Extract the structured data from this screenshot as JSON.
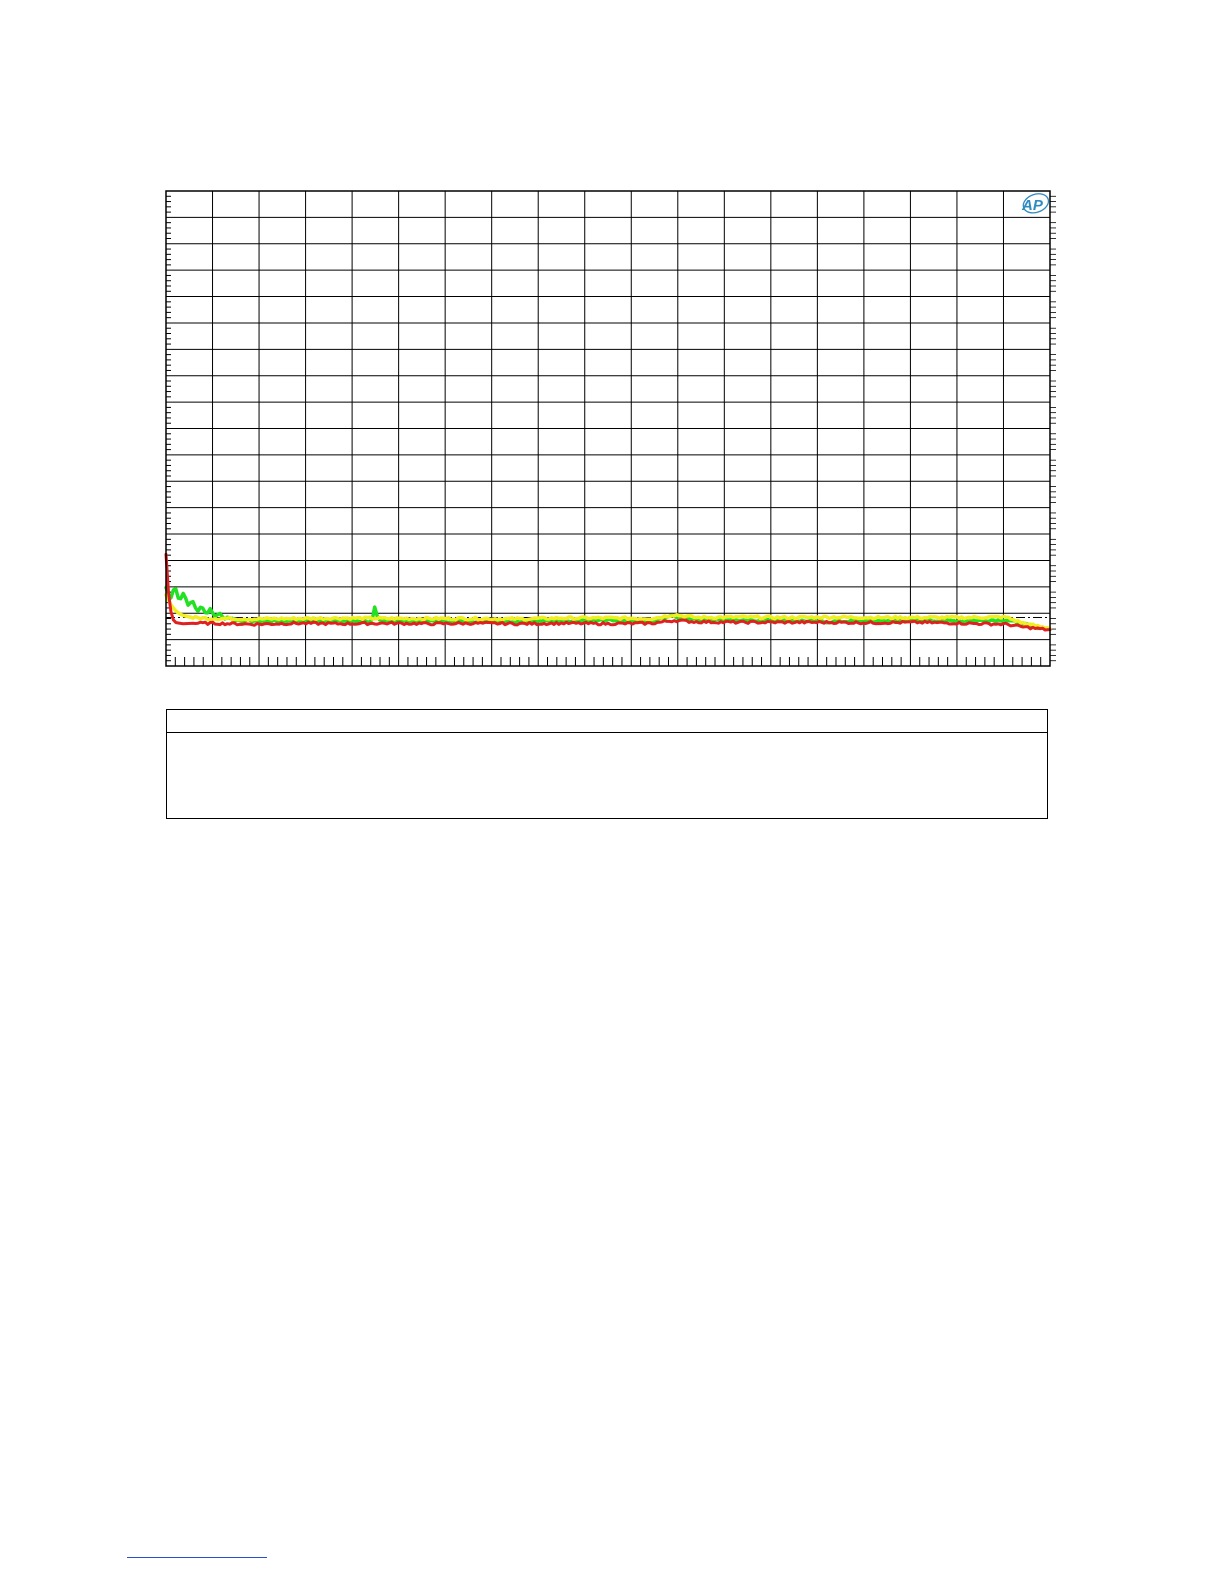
{
  "logo": {
    "text": "AP",
    "color": "#2e8bc0"
  },
  "chart_data": {
    "type": "line",
    "title": "",
    "xlabel": "",
    "ylabel": "",
    "xlim": [
      0,
      100
    ],
    "ylim": [
      0,
      100
    ],
    "x_major_divisions": 19,
    "y_major_divisions": 18,
    "grid": true,
    "reference_line": {
      "y": 10.2,
      "color": "#000000",
      "style": "dash-dot"
    },
    "series": [
      {
        "color": "#22e022",
        "x": [
          0,
          0.5,
          1,
          1.5,
          2,
          2.5,
          3,
          3.5,
          4,
          4.5,
          5,
          5.5,
          6,
          6.5,
          7,
          8,
          10,
          15,
          20,
          23.3,
          23.6,
          24,
          30,
          40,
          50,
          55,
          57,
          60,
          70,
          75,
          80,
          90,
          95,
          97,
          99,
          100
        ],
        "values": [
          16.5,
          14.0,
          17.0,
          13.5,
          15.5,
          12.8,
          13.8,
          11.4,
          12.8,
          11.0,
          11.9,
          10.4,
          11.2,
          10.0,
          10.3,
          9.6,
          9.5,
          9.5,
          9.5,
          9.4,
          12.3,
          9.5,
          9.4,
          9.4,
          9.6,
          9.4,
          10.5,
          9.8,
          9.6,
          9.3,
          9.6,
          9.5,
          9.7,
          8.8,
          8.0,
          7.8
        ]
      },
      {
        "color": "#f2ee22",
        "x": [
          0,
          0.5,
          1,
          1.5,
          2,
          3,
          5,
          7,
          10,
          15,
          20,
          25,
          30,
          35,
          40,
          45,
          50,
          55,
          57.5,
          60,
          65,
          70,
          75,
          80,
          85,
          90,
          95,
          97,
          99,
          100
        ],
        "values": [
          15.0,
          13.0,
          11.8,
          11.0,
          10.6,
          10.2,
          10.0,
          10.0,
          9.9,
          10.0,
          10.1,
          10.0,
          10.0,
          10.0,
          9.9,
          10.1,
          10.1,
          10.0,
          10.8,
          10.2,
          10.3,
          10.2,
          10.3,
          10.2,
          10.2,
          10.2,
          10.3,
          9.0,
          8.2,
          8.0
        ]
      },
      {
        "color": "#e02020",
        "x": [
          0,
          0.2,
          0.4,
          0.6,
          0.8,
          1,
          1.5,
          2,
          3,
          5,
          10,
          15,
          20,
          25,
          30,
          35,
          40,
          45,
          50,
          55,
          57.5,
          60,
          65,
          70,
          75,
          80,
          85,
          90,
          95,
          97,
          99,
          100
        ],
        "values": [
          23.5,
          17.0,
          13.0,
          11.0,
          9.8,
          9.2,
          9.0,
          8.9,
          9.0,
          9.0,
          8.8,
          9.0,
          8.9,
          9.0,
          8.9,
          9.0,
          8.9,
          9.0,
          8.9,
          9.0,
          9.6,
          9.3,
          9.2,
          9.2,
          9.2,
          9.1,
          9.2,
          9.0,
          8.8,
          8.2,
          7.8,
          7.6
        ]
      }
    ]
  },
  "legend_table": {
    "header": "",
    "rows": []
  }
}
